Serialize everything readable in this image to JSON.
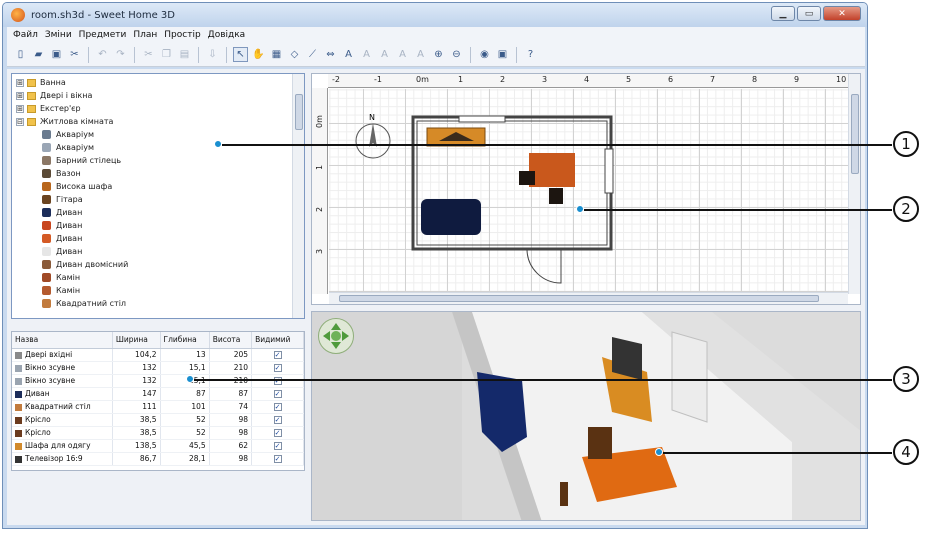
{
  "window": {
    "title": "room.sh3d - Sweet Home 3D",
    "min_label": "▁",
    "max_label": "▭",
    "close_label": "✕"
  },
  "menu": [
    "Файл",
    "Зміни",
    "Предмети",
    "План",
    "Простір",
    "Довідка"
  ],
  "catalog": {
    "categories": [
      {
        "label": "Ванна",
        "expander": "⊞"
      },
      {
        "label": "Двері і вікна",
        "expander": "⊞"
      },
      {
        "label": "Екстер'єр",
        "expander": "⊞"
      },
      {
        "label": "Житлова кімната",
        "expander": "⊟"
      }
    ],
    "items": [
      {
        "label": "Акваріум",
        "color": "#6a7b8f"
      },
      {
        "label": "Акваріум",
        "color": "#9aa6b5"
      },
      {
        "label": "Барний стілець",
        "color": "#8b7765"
      },
      {
        "label": "Вазон",
        "color": "#5b4a36"
      },
      {
        "label": "Висока шафа",
        "color": "#b8661c"
      },
      {
        "label": "Гітара",
        "color": "#6b4420"
      },
      {
        "label": "Диван",
        "color": "#1c2d5a"
      },
      {
        "label": "Диван",
        "color": "#c8461e"
      },
      {
        "label": "Диван",
        "color": "#d45a25"
      },
      {
        "label": "Диван",
        "color": "#e6e6e6"
      },
      {
        "label": "Диван двомісний",
        "color": "#8a5b3a"
      },
      {
        "label": "Камін",
        "color": "#a04a26"
      },
      {
        "label": "Камін",
        "color": "#b45a2e"
      },
      {
        "label": "Квадратний стіл",
        "color": "#c27b3d"
      }
    ]
  },
  "furniture_table": {
    "headers": [
      "Назва",
      "Ширина",
      "Глибина",
      "Висота",
      "Видимий"
    ],
    "rows": [
      {
        "name": "Двері вхідні",
        "width": "104,2",
        "depth": "13",
        "height": "205",
        "visible": true,
        "color": "#8a8a8a"
      },
      {
        "name": "Вікно зсувне",
        "width": "132",
        "depth": "15,1",
        "height": "210",
        "visible": true,
        "color": "#9aa4b0"
      },
      {
        "name": "Вікно зсувне",
        "width": "132",
        "depth": "15,1",
        "height": "210",
        "visible": true,
        "color": "#9aa4b0"
      },
      {
        "name": "Диван",
        "width": "147",
        "depth": "87",
        "height": "87",
        "visible": true,
        "color": "#1c2d5a"
      },
      {
        "name": "Квадратний стіл",
        "width": "111",
        "depth": "101",
        "height": "74",
        "visible": true,
        "color": "#c27b3d"
      },
      {
        "name": "Крісло",
        "width": "38,5",
        "depth": "52",
        "height": "98",
        "visible": true,
        "color": "#6b3b1f"
      },
      {
        "name": "Крісло",
        "width": "38,5",
        "depth": "52",
        "height": "98",
        "visible": true,
        "color": "#6b3b1f"
      },
      {
        "name": "Шафа для одягу",
        "width": "138,5",
        "depth": "45,5",
        "height": "62",
        "visible": true,
        "color": "#d28a2c"
      },
      {
        "name": "Телевізор 16:9",
        "width": "86,7",
        "depth": "28,1",
        "height": "98",
        "visible": true,
        "color": "#333333"
      }
    ]
  },
  "plan": {
    "ruler_x": [
      "-2",
      "-1",
      "0m",
      "1",
      "2",
      "3",
      "4",
      "5",
      "6",
      "7",
      "8",
      "9",
      "10"
    ],
    "ruler_y": [
      "0m",
      "1",
      "2",
      "3"
    ],
    "compass_label": "N",
    "wall_color": "#444444",
    "sofa_color": "#0f1b3f",
    "table_color": "#c9581c",
    "cabinet_color": "#c27b3d"
  },
  "callouts": [
    "1",
    "2",
    "3",
    "4"
  ],
  "colors": {
    "accent": "#1a8fd0"
  }
}
